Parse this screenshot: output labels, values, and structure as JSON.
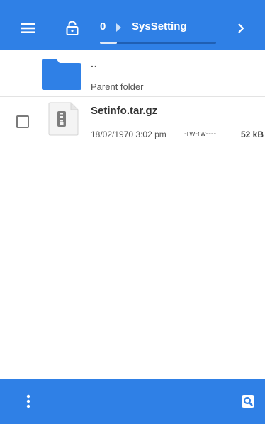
{
  "toolbar": {
    "menu_icon": "hamburger-menu-icon",
    "lock_icon": "unlock-icon",
    "next_icon": "chevron-right-icon"
  },
  "breadcrumb": {
    "root": "0",
    "separator_icon": "triangle-right-icon",
    "current": "SysSetting"
  },
  "files": {
    "parent": {
      "name": "..",
      "label": "Parent folder",
      "icon": "folder-icon",
      "icon_color": "#2f80e6"
    },
    "items": [
      {
        "name": "Setinfo.tar.gz",
        "date": "18/02/1970 3:02 pm",
        "permissions": "-rw-rw----",
        "size": "52 kB",
        "icon": "archive-file-icon",
        "checked": false
      }
    ]
  },
  "bottombar": {
    "more_icon": "more-vertical-icon",
    "search_icon": "search-icon"
  },
  "colors": {
    "accent": "#2f80e6",
    "background": "#ffffff",
    "text_primary": "#333333",
    "text_secondary": "#555555"
  }
}
